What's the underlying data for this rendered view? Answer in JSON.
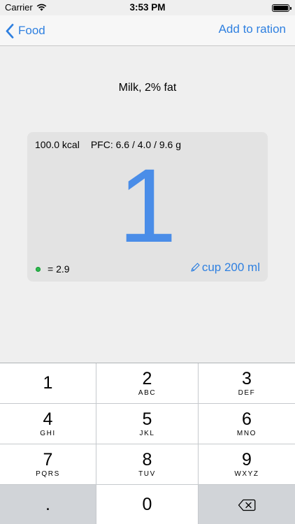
{
  "status_bar": {
    "carrier": "Carrier",
    "time": "3:53 PM"
  },
  "nav": {
    "back_label": "Food",
    "action_label": "Add to ration"
  },
  "food": {
    "name": "Milk, 2% fat"
  },
  "portion": {
    "energy": "100.0 kcal",
    "pfc": "PFC: 6.6 / 4.0 / 9.6 g",
    "quantity": "1",
    "points": "= 2.9",
    "unit": "cup 200 ml"
  },
  "keypad": {
    "keys": [
      {
        "digit": "1",
        "letters": ""
      },
      {
        "digit": "2",
        "letters": "ABC"
      },
      {
        "digit": "3",
        "letters": "DEF"
      },
      {
        "digit": "4",
        "letters": "GHI"
      },
      {
        "digit": "5",
        "letters": "JKL"
      },
      {
        "digit": "6",
        "letters": "MNO"
      },
      {
        "digit": "7",
        "letters": "PQRS"
      },
      {
        "digit": "8",
        "letters": "TUV"
      },
      {
        "digit": "9",
        "letters": "WXYZ"
      },
      {
        "digit": ".",
        "letters": ""
      },
      {
        "digit": "0",
        "letters": ""
      }
    ]
  },
  "colors": {
    "accent": "#2f80e0",
    "quantity": "#4a8de8",
    "points_dot": "#2fb94e"
  },
  "icons": [
    "wifi-icon",
    "battery-icon",
    "back-chevron-icon",
    "pencil-icon",
    "backspace-icon"
  ]
}
